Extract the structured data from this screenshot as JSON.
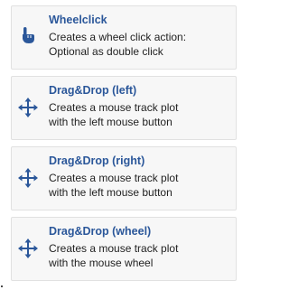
{
  "actions": [
    {
      "title": "Wheelclick",
      "desc_line1": "Creates a wheel click action:",
      "desc_line2": "Optional as double click",
      "icon": "hand-pointer-icon"
    },
    {
      "title": "Drag&Drop (left)",
      "desc_line1": "Creates a mouse track plot",
      "desc_line2": "with the left mouse button",
      "icon": "move-arrows-icon"
    },
    {
      "title": "Drag&Drop (right)",
      "desc_line1": "Creates a mouse track plot",
      "desc_line2": "with the left mouse button",
      "icon": "move-arrows-icon"
    },
    {
      "title": "Drag&Drop (wheel)",
      "desc_line1": "Creates a mouse track plot",
      "desc_line2": "with the mouse wheel",
      "icon": "move-arrows-icon"
    }
  ],
  "colors": {
    "title": "#2b579a",
    "icon": "#2b579a",
    "card_background": "#f7f7f7",
    "card_border": "#e1e1e1"
  }
}
